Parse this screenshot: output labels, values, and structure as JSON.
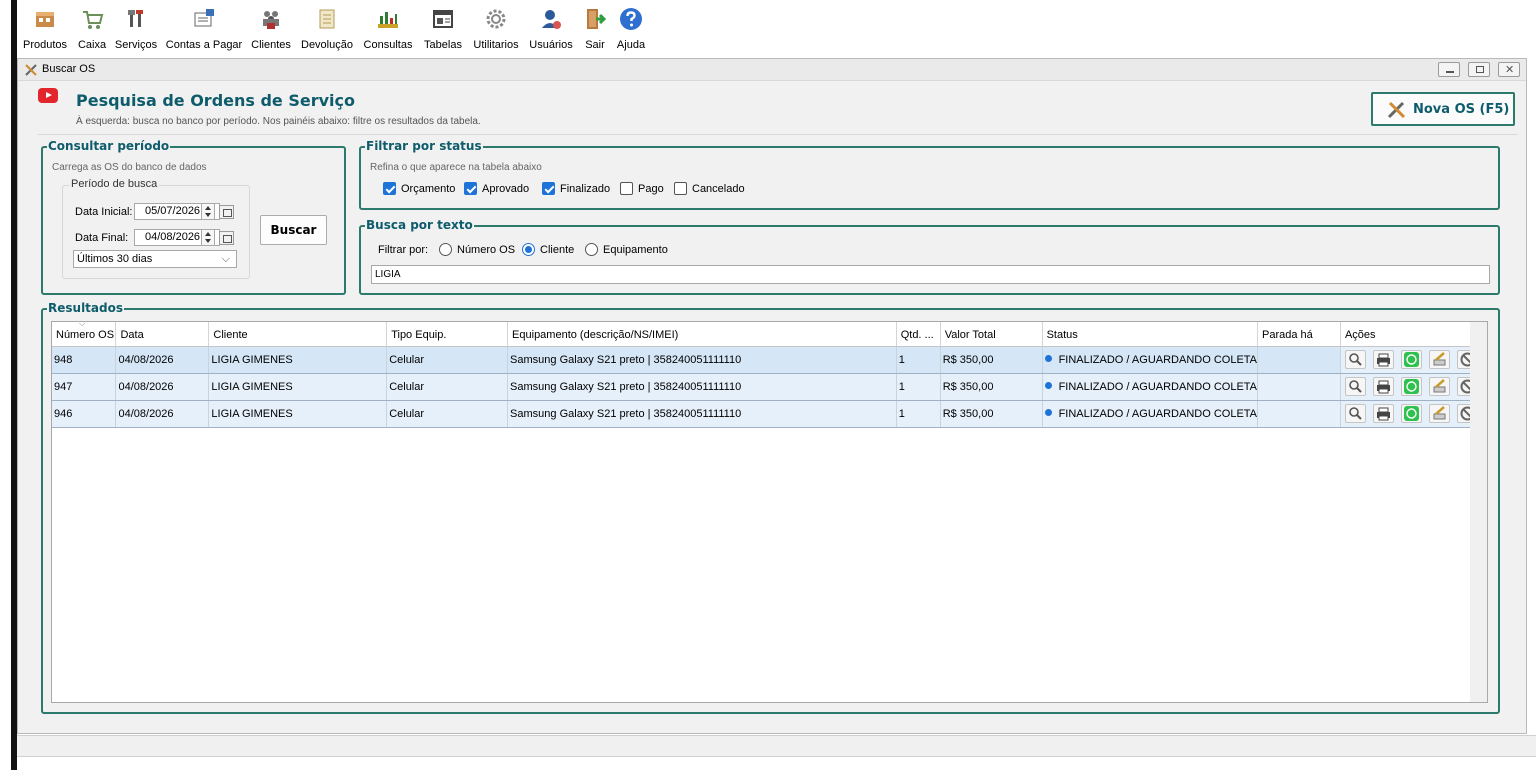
{
  "toolbar": {
    "items": [
      {
        "label": "Produtos",
        "icon": "products-icon"
      },
      {
        "label": "Caixa",
        "icon": "cart-icon"
      },
      {
        "label": "Serviços",
        "icon": "tools-icon"
      },
      {
        "label": "Contas a Pagar",
        "icon": "bills-icon"
      },
      {
        "label": "Clientes",
        "icon": "people-icon"
      },
      {
        "label": "Devolução",
        "icon": "return-icon"
      },
      {
        "label": "Consultas",
        "icon": "chart-icon"
      },
      {
        "label": "Tabelas",
        "icon": "table-icon"
      },
      {
        "label": "Utilitarios",
        "icon": "gear-icon"
      },
      {
        "label": "Usuários",
        "icon": "user-icon"
      },
      {
        "label": "Sair",
        "icon": "exit-icon"
      },
      {
        "label": "Ajuda",
        "icon": "help-icon"
      }
    ]
  },
  "window": {
    "title": "Buscar OS"
  },
  "header": {
    "title": "Pesquisa de Ordens de Serviço",
    "subtitle": "À esquerda: busca no banco por período. Nos painéis abaixo: filtre os resultados da tabela.",
    "new_os_label": "Nova OS (F5)"
  },
  "periodo": {
    "title": "Consultar período",
    "desc": "Carrega as OS do banco de dados",
    "subgroup_title": "Período de busca",
    "data_inicial_label": "Data Inicial:",
    "data_inicial": "05/07/2026",
    "data_final_label": "Data Final:",
    "data_final": "04/08/2026",
    "preset": "Últimos 30 dias",
    "buscar_label": "Buscar"
  },
  "status_filter": {
    "title": "Filtrar por status",
    "desc": "Refina o que aparece na tabela abaixo",
    "options": [
      {
        "label": "Orçamento",
        "checked": true
      },
      {
        "label": "Aprovado",
        "checked": true
      },
      {
        "label": "Finalizado",
        "checked": true
      },
      {
        "label": "Pago",
        "checked": false
      },
      {
        "label": "Cancelado",
        "checked": false
      }
    ]
  },
  "text_search": {
    "title": "Busca por texto",
    "filter_label": "Filtrar por:",
    "options": [
      {
        "label": "Número OS",
        "selected": false
      },
      {
        "label": "Cliente",
        "selected": true
      },
      {
        "label": "Equipamento",
        "selected": false
      }
    ],
    "value": "LIGIA"
  },
  "results": {
    "title": "Resultados",
    "columns": [
      "Número OS",
      "Data",
      "Cliente",
      "Tipo Equip.",
      "Equipamento (descrição/NS/IMEI)",
      "Qtd. ...",
      "Valor Total",
      "Status",
      "Parada há",
      "Ações"
    ],
    "rows": [
      [
        "948",
        "04/08/2026",
        "LIGIA GIMENES",
        "Celular",
        "Samsung Galaxy S21 preto | 358240051111110",
        "1",
        "R$ 350,00",
        "FINALIZADO / AGUARDANDO COLETA",
        ""
      ],
      [
        "947",
        "04/08/2026",
        "LIGIA GIMENES",
        "Celular",
        "Samsung Galaxy S21 preto | 358240051111110",
        "1",
        "R$ 350,00",
        "FINALIZADO / AGUARDANDO COLETA",
        ""
      ],
      [
        "946",
        "04/08/2026",
        "LIGIA GIMENES",
        "Celular",
        "Samsung Galaxy S21 preto | 358240051111110",
        "1",
        "R$ 350,00",
        "FINALIZADO / AGUARDANDO COLETA",
        ""
      ]
    ],
    "actions": [
      "view-icon",
      "print-icon",
      "whatsapp-icon",
      "edit-icon",
      "cancel-icon"
    ]
  },
  "colors": {
    "accent": "#2b7a6c",
    "title": "#0e5c6b",
    "status_dot": "#1e73d8",
    "row": "#e6f0fa"
  }
}
